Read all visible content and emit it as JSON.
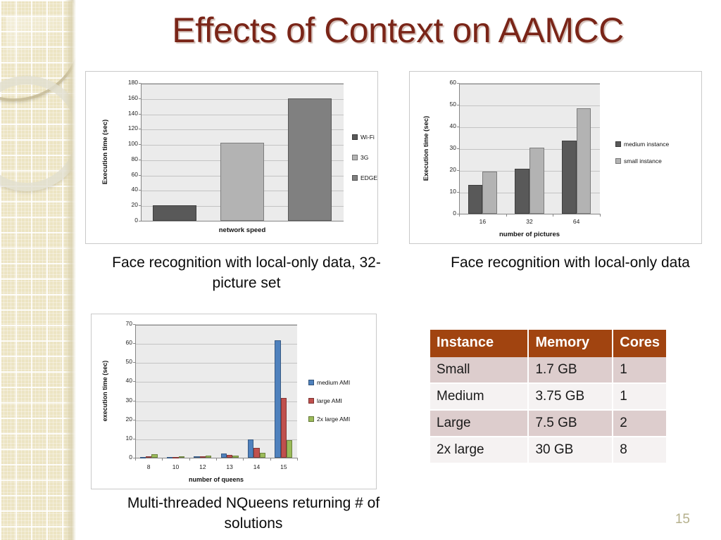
{
  "slide": {
    "title": "Effects of Context on AAMCC",
    "page_number": "15",
    "title_color": "#7a2518"
  },
  "captions": {
    "chart1": "Face recognition with local-only data, 32-picture set",
    "chart2": "Face recognition with local-only data",
    "chart3": "Multi-threaded NQueens returning # of solutions"
  },
  "table": {
    "headers": [
      "Instance",
      "Memory",
      "Cores"
    ],
    "header_bg": "#a14410",
    "rows": [
      [
        "Small",
        "1.7 GB",
        "1"
      ],
      [
        "Medium",
        "3.75 GB",
        "1"
      ],
      [
        "Large",
        "7.5 GB",
        "2"
      ],
      [
        "2x large",
        "30 GB",
        "8"
      ]
    ]
  },
  "chart_data": [
    {
      "id": "chart1",
      "type": "bar",
      "title": "",
      "xlabel": "network speed",
      "ylabel": "Execution time (sec)",
      "categories": [
        "Wi-Fi",
        "3G",
        "EDGE"
      ],
      "values": [
        20.5,
        102,
        160
      ],
      "ylim": [
        0,
        180
      ],
      "yticks": [
        0,
        20,
        40,
        60,
        80,
        100,
        120,
        140,
        160,
        180
      ],
      "xticks": [],
      "grid": true,
      "legend": [
        "Wi-Fi",
        "3G",
        "EDGE"
      ],
      "legend_position": "right",
      "colors": [
        "#595959",
        "#b3b3b3",
        "#808080"
      ],
      "plot_bg": "#ebebeb"
    },
    {
      "id": "chart2",
      "type": "bar",
      "title": "",
      "xlabel": "number of pictures",
      "ylabel": "Execution time (sec)",
      "categories": [
        "16",
        "32",
        "64"
      ],
      "series": [
        {
          "name": "medium instance",
          "values": [
            13.2,
            20.5,
            33.6
          ],
          "color": "#595959"
        },
        {
          "name": "small instance",
          "values": [
            19.3,
            30.2,
            48.5
          ],
          "color": "#b3b3b3"
        }
      ],
      "ylim": [
        0,
        60
      ],
      "yticks": [
        0,
        10,
        20,
        30,
        40,
        50,
        60
      ],
      "grid": true,
      "legend_position": "right",
      "plot_bg": "#ebebeb"
    },
    {
      "id": "chart3",
      "type": "bar",
      "title": "",
      "xlabel": "number of queens",
      "ylabel": "execution time (sec)",
      "categories": [
        "8",
        "10",
        "12",
        "13",
        "14",
        "15"
      ],
      "series": [
        {
          "name": "medium AMI",
          "values": [
            0.4,
            0.4,
            0.8,
            2.2,
            9.4,
            61.5
          ],
          "color": "#4f81bd"
        },
        {
          "name": "large AMI",
          "values": [
            0.8,
            0.5,
            0.9,
            1.5,
            5.3,
            31.4
          ],
          "color": "#c0504d"
        },
        {
          "name": "2x large AMI",
          "values": [
            1.8,
            0.8,
            1.1,
            1.2,
            2.7,
            9.1
          ],
          "color": "#9bbb59"
        }
      ],
      "ylim": [
        0,
        70
      ],
      "yticks": [
        0,
        10,
        20,
        30,
        40,
        50,
        60,
        70
      ],
      "grid": true,
      "legend_position": "right",
      "plot_bg": "#ebebeb"
    }
  ]
}
